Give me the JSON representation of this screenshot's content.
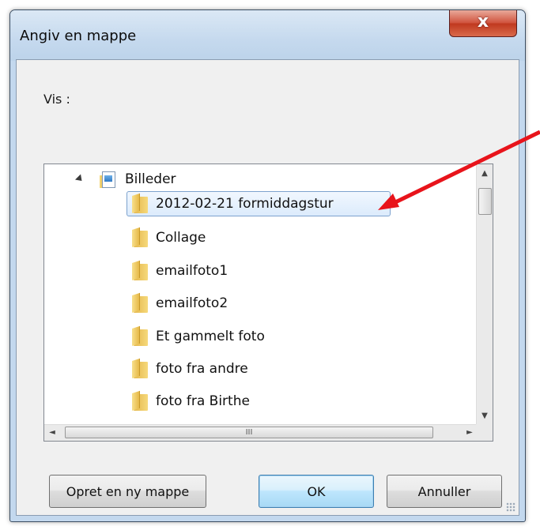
{
  "window": {
    "title": "Angiv en mappe",
    "close_symbol": "x"
  },
  "vis_label": "Vis :",
  "tree": {
    "root": {
      "label": "Billeder",
      "icon": "library-pictures-icon",
      "expanded": true
    },
    "items": [
      {
        "label": "2012-02-21 formiddagstur",
        "selected": true
      },
      {
        "label": "Collage"
      },
      {
        "label": "emailfoto1"
      },
      {
        "label": "emailfoto2"
      },
      {
        "label": "Et gammelt foto"
      },
      {
        "label": "foto fra andre"
      },
      {
        "label": "foto fra Birthe"
      }
    ]
  },
  "scrollbar": {
    "up": "▲",
    "down": "▼",
    "left": "◄",
    "right": "►",
    "grip": "III"
  },
  "buttons": {
    "new_folder": "Opret en ny mappe",
    "ok": "OK",
    "cancel": "Annuller"
  },
  "colors": {
    "annotation_arrow": "#e8141b",
    "title_bar": "#c5d9ee",
    "selection_border": "#7da2ce"
  }
}
